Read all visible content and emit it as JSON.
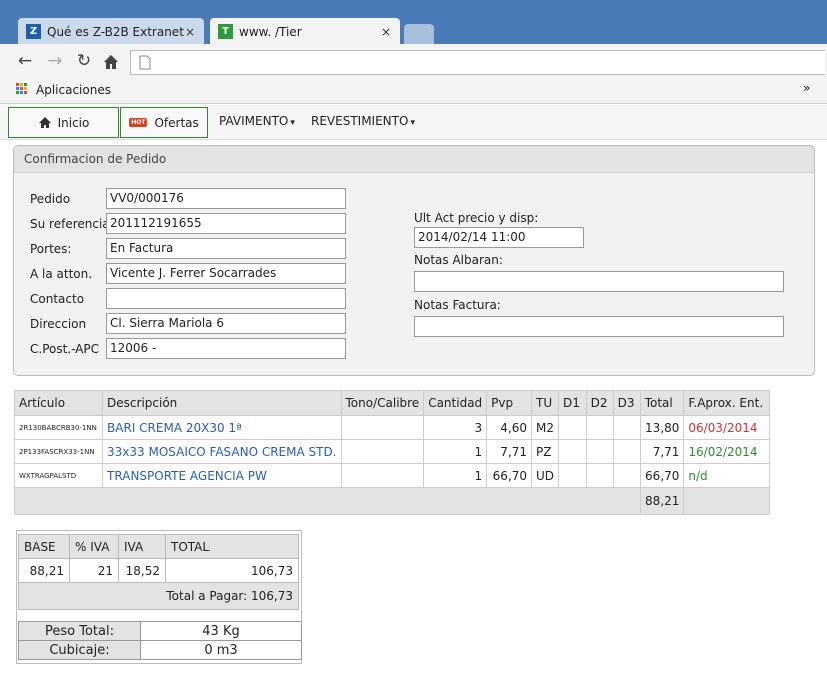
{
  "browser": {
    "tabs": [
      {
        "title": "Qué es Z-B2B Extranet",
        "icon": "zb-favicon",
        "close": "×"
      },
      {
        "title": "www.                /Tier",
        "icon": "t-favicon",
        "close": "×"
      }
    ],
    "bookmarks": {
      "apps_label": "Aplicaciones",
      "more": "»"
    }
  },
  "nav": {
    "inicio": "Inicio",
    "ofertas": "Ofertas",
    "hot_badge": "HOT",
    "pavimento": "PAVIMENTO",
    "revestimiento": "REVESTIMIENTO",
    "caret": "▾"
  },
  "order": {
    "header": "Confirmacion de Pedido",
    "fields": [
      {
        "label": "Pedido",
        "value": "VV0/000176"
      },
      {
        "label": "Su referencia",
        "value": "201112191655"
      },
      {
        "label": "Portes:",
        "value": "En Factura"
      },
      {
        "label": "A la atton.",
        "value": "Vicente J. Ferrer Socarrades"
      },
      {
        "label": "Contacto",
        "value": ""
      },
      {
        "label": "Direccion",
        "value": "Cl. Sierra Mariola 6"
      },
      {
        "label": "C.Post.-APC",
        "value": "12006 -"
      }
    ],
    "right": {
      "ult_act_label": "Ult Act precio y disp:",
      "ult_act_value": "2014/02/14  11:00",
      "notas_albaran_label": "Notas Albaran:",
      "notas_albaran_value": "",
      "notas_factura_label": "Notas Factura:",
      "notas_factura_value": ""
    }
  },
  "lines": {
    "headers": [
      "Artículo",
      "Descripción",
      "Tono/Calibre",
      "Cantidad",
      "Pvp",
      "TU",
      "D1",
      "D2",
      "D3",
      "Total",
      "F.Aprox. Ent."
    ],
    "rows": [
      {
        "articulo": "2R130BABCRB30-1NN",
        "descripcion": "BARI CREMA 20X30 1ª",
        "tono": "",
        "cantidad": "3",
        "pvp": "4,60",
        "tu": "M2",
        "d1": "",
        "d2": "",
        "d3": "",
        "total": "13,80",
        "fecha": "06/03/2014",
        "fecha_color": "#d03030"
      },
      {
        "articulo": "2P133FASCRX33-1NN",
        "descripcion": "33x33 MOSAICO FASANO CREMA STD.",
        "tono": "",
        "cantidad": "1",
        "pvp": "7,71",
        "tu": "PZ",
        "d1": "",
        "d2": "",
        "d3": "",
        "total": "7,71",
        "fecha": "16/02/2014",
        "fecha_color": "#2e8b2e"
      },
      {
        "articulo": "WXTRAGPALSTD",
        "descripcion": "TRANSPORTE AGENCIA PW",
        "tono": "",
        "cantidad": "1",
        "pvp": "66,70",
        "tu": "UD",
        "d1": "",
        "d2": "",
        "d3": "",
        "total": "66,70",
        "fecha": "n/d",
        "fecha_color": "#2e8b2e"
      }
    ],
    "grand_total": "88,21"
  },
  "taxes": {
    "headers": [
      "BASE",
      "% IVA",
      "IVA",
      "TOTAL"
    ],
    "row": [
      "88,21",
      "21",
      "18,52",
      "106,73"
    ],
    "total_label": "Total a Pagar: 106,73"
  },
  "logistics": {
    "peso_label": "Peso Total:",
    "peso_value": "43 Kg",
    "cubicaje_label": "Cubicaje:",
    "cubicaje_value": "0 m3"
  }
}
